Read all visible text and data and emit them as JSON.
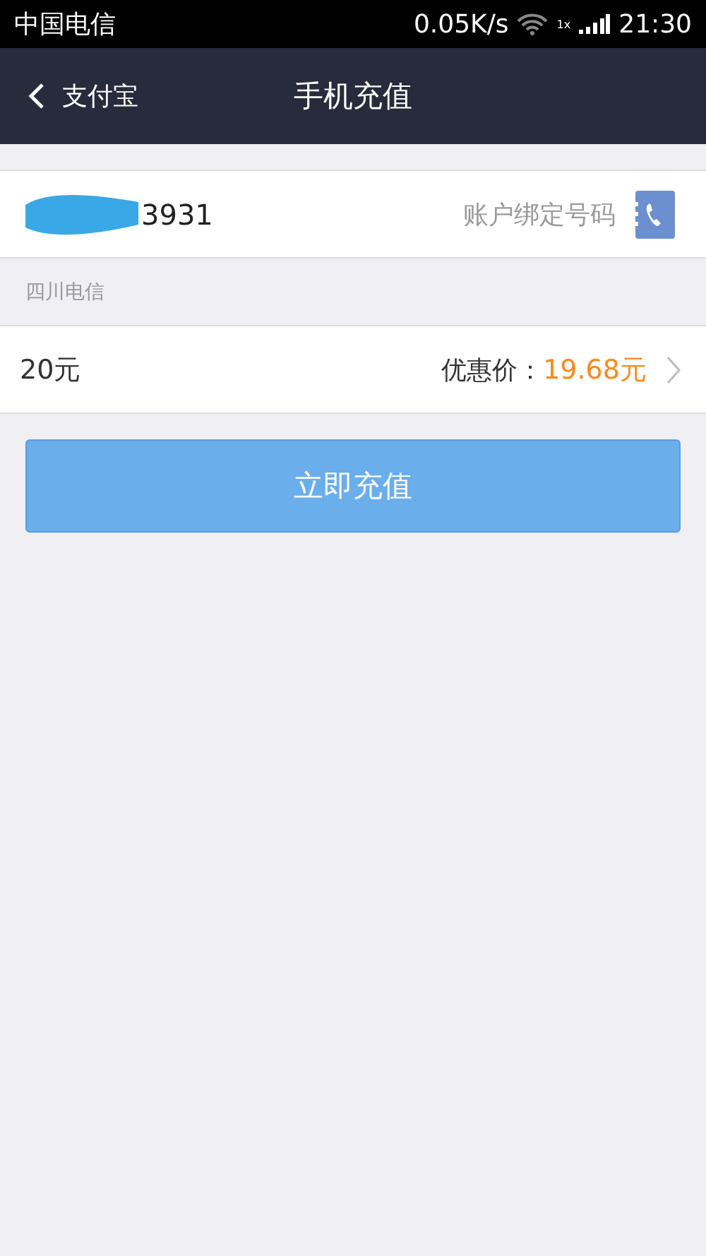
{
  "status_bar": {
    "carrier": "中国电信",
    "speed": "0.05K/s",
    "network": "1x",
    "time": "21:30"
  },
  "nav": {
    "back": "支付宝",
    "title": "手机充值"
  },
  "phone": {
    "value": "3931",
    "hint": "账户绑定号码"
  },
  "operator": "四川电信",
  "amount": {
    "value": "20元",
    "price_label": "优惠价：",
    "price": "19.68元"
  },
  "button": "立即充值"
}
